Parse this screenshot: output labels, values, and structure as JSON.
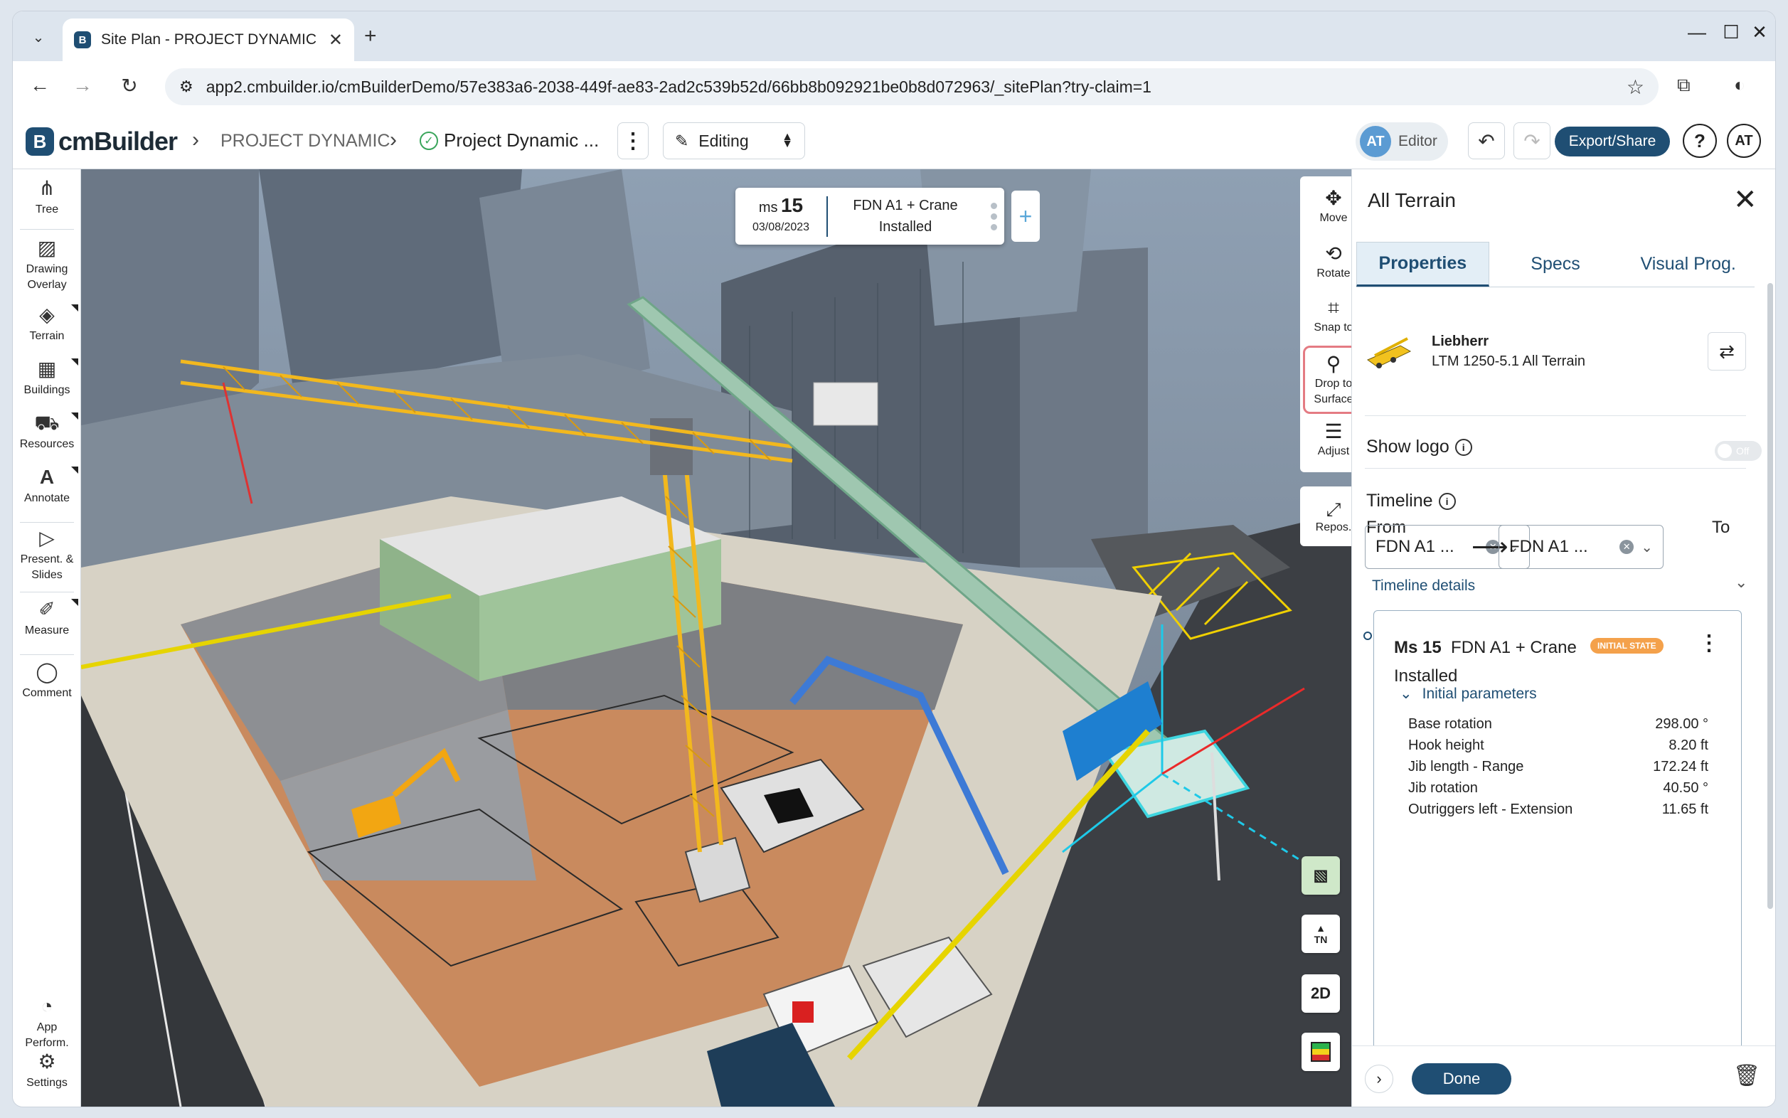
{
  "browser": {
    "tab_title": "Site Plan - PROJECT DYNAMIC |",
    "url": "app2.cmbuilder.io/cmBuilderDemo/57e383a6-2038-449f-ae83-2ad2c539b52d/66bb8b092921be0b8d072963/_sitePlan?try-claim=1"
  },
  "header": {
    "logo_text": "cmBuilder",
    "breadcrumb_project": "PROJECT DYNAMIC",
    "breadcrumb_plan": "Project Dynamic ...",
    "mode": "Editing",
    "avatar_initials": "AT",
    "role": "Editor",
    "export_label": "Export/Share",
    "help": "?",
    "user_initials": "AT"
  },
  "left_tools": [
    {
      "label": "Tree",
      "icon": "tree-icon"
    },
    {
      "label": "Drawing Overlay",
      "icon": "image-icon"
    },
    {
      "label": "Terrain",
      "icon": "terrain-icon"
    },
    {
      "label": "Buildings",
      "icon": "building-icon"
    },
    {
      "label": "Resources",
      "icon": "resources-icon"
    },
    {
      "label": "Annotate",
      "icon": "annotate-icon"
    },
    {
      "label": "Present. & Slides",
      "icon": "presentation-icon"
    },
    {
      "label": "Measure",
      "icon": "ruler-icon"
    },
    {
      "label": "Comment",
      "icon": "comment-icon"
    },
    {
      "label": "App Perform.",
      "icon": "speedometer-icon"
    },
    {
      "label": "Settings",
      "icon": "gear-icon"
    }
  ],
  "milestone_card": {
    "prefix": "ms",
    "number": "15",
    "date": "03/08/2023",
    "title_line1": "FDN A1 + Crane",
    "title_line2": "Installed",
    "add": "+"
  },
  "transform_tools": [
    {
      "label": "Move",
      "icon": "move-icon"
    },
    {
      "label": "Rotate",
      "icon": "rotate-icon"
    },
    {
      "label": "Snap to",
      "icon": "snap-icon"
    },
    {
      "label": "Drop to Surface",
      "icon": "drop-pin-icon"
    },
    {
      "label": "Adjust",
      "icon": "sliders-icon"
    }
  ],
  "repos_label": "Repos.",
  "view_buttons": {
    "north": "TN",
    "two_d": "2D"
  },
  "panel": {
    "title": "All Terrain",
    "tabs": [
      "Properties",
      "Specs",
      "Visual Prog."
    ],
    "equipment_brand": "Liebherr",
    "equipment_model": "LTM 1250-5.1 All Terrain",
    "show_logo_label": "Show logo",
    "toggle_text": "Off",
    "timeline_label": "Timeline",
    "from_label": "From",
    "to_label": "To",
    "from_value": "FDN A1 ...",
    "to_value": "FDN A1 ...",
    "timeline_details": "Timeline details",
    "milestone": {
      "prefix": "Ms 15",
      "title": "FDN A1 + Crane Installed",
      "badge": "INITIAL STATE",
      "params_label": "Initial parameters",
      "params": [
        {
          "name": "Base rotation",
          "value": "298.00 °"
        },
        {
          "name": "Hook height",
          "value": "8.20 ft"
        },
        {
          "name": "Jib length - Range",
          "value": "172.24 ft"
        },
        {
          "name": "Jib rotation",
          "value": "40.50 °"
        },
        {
          "name": "Outriggers left - Extension",
          "value": "11.65 ft"
        }
      ]
    },
    "done_label": "Done"
  },
  "colors": {
    "brand": "#1f4e73",
    "crane_yellow": "#f2b81e",
    "boom_green": "#9fc7b0",
    "excavation": "#c98a5e"
  }
}
